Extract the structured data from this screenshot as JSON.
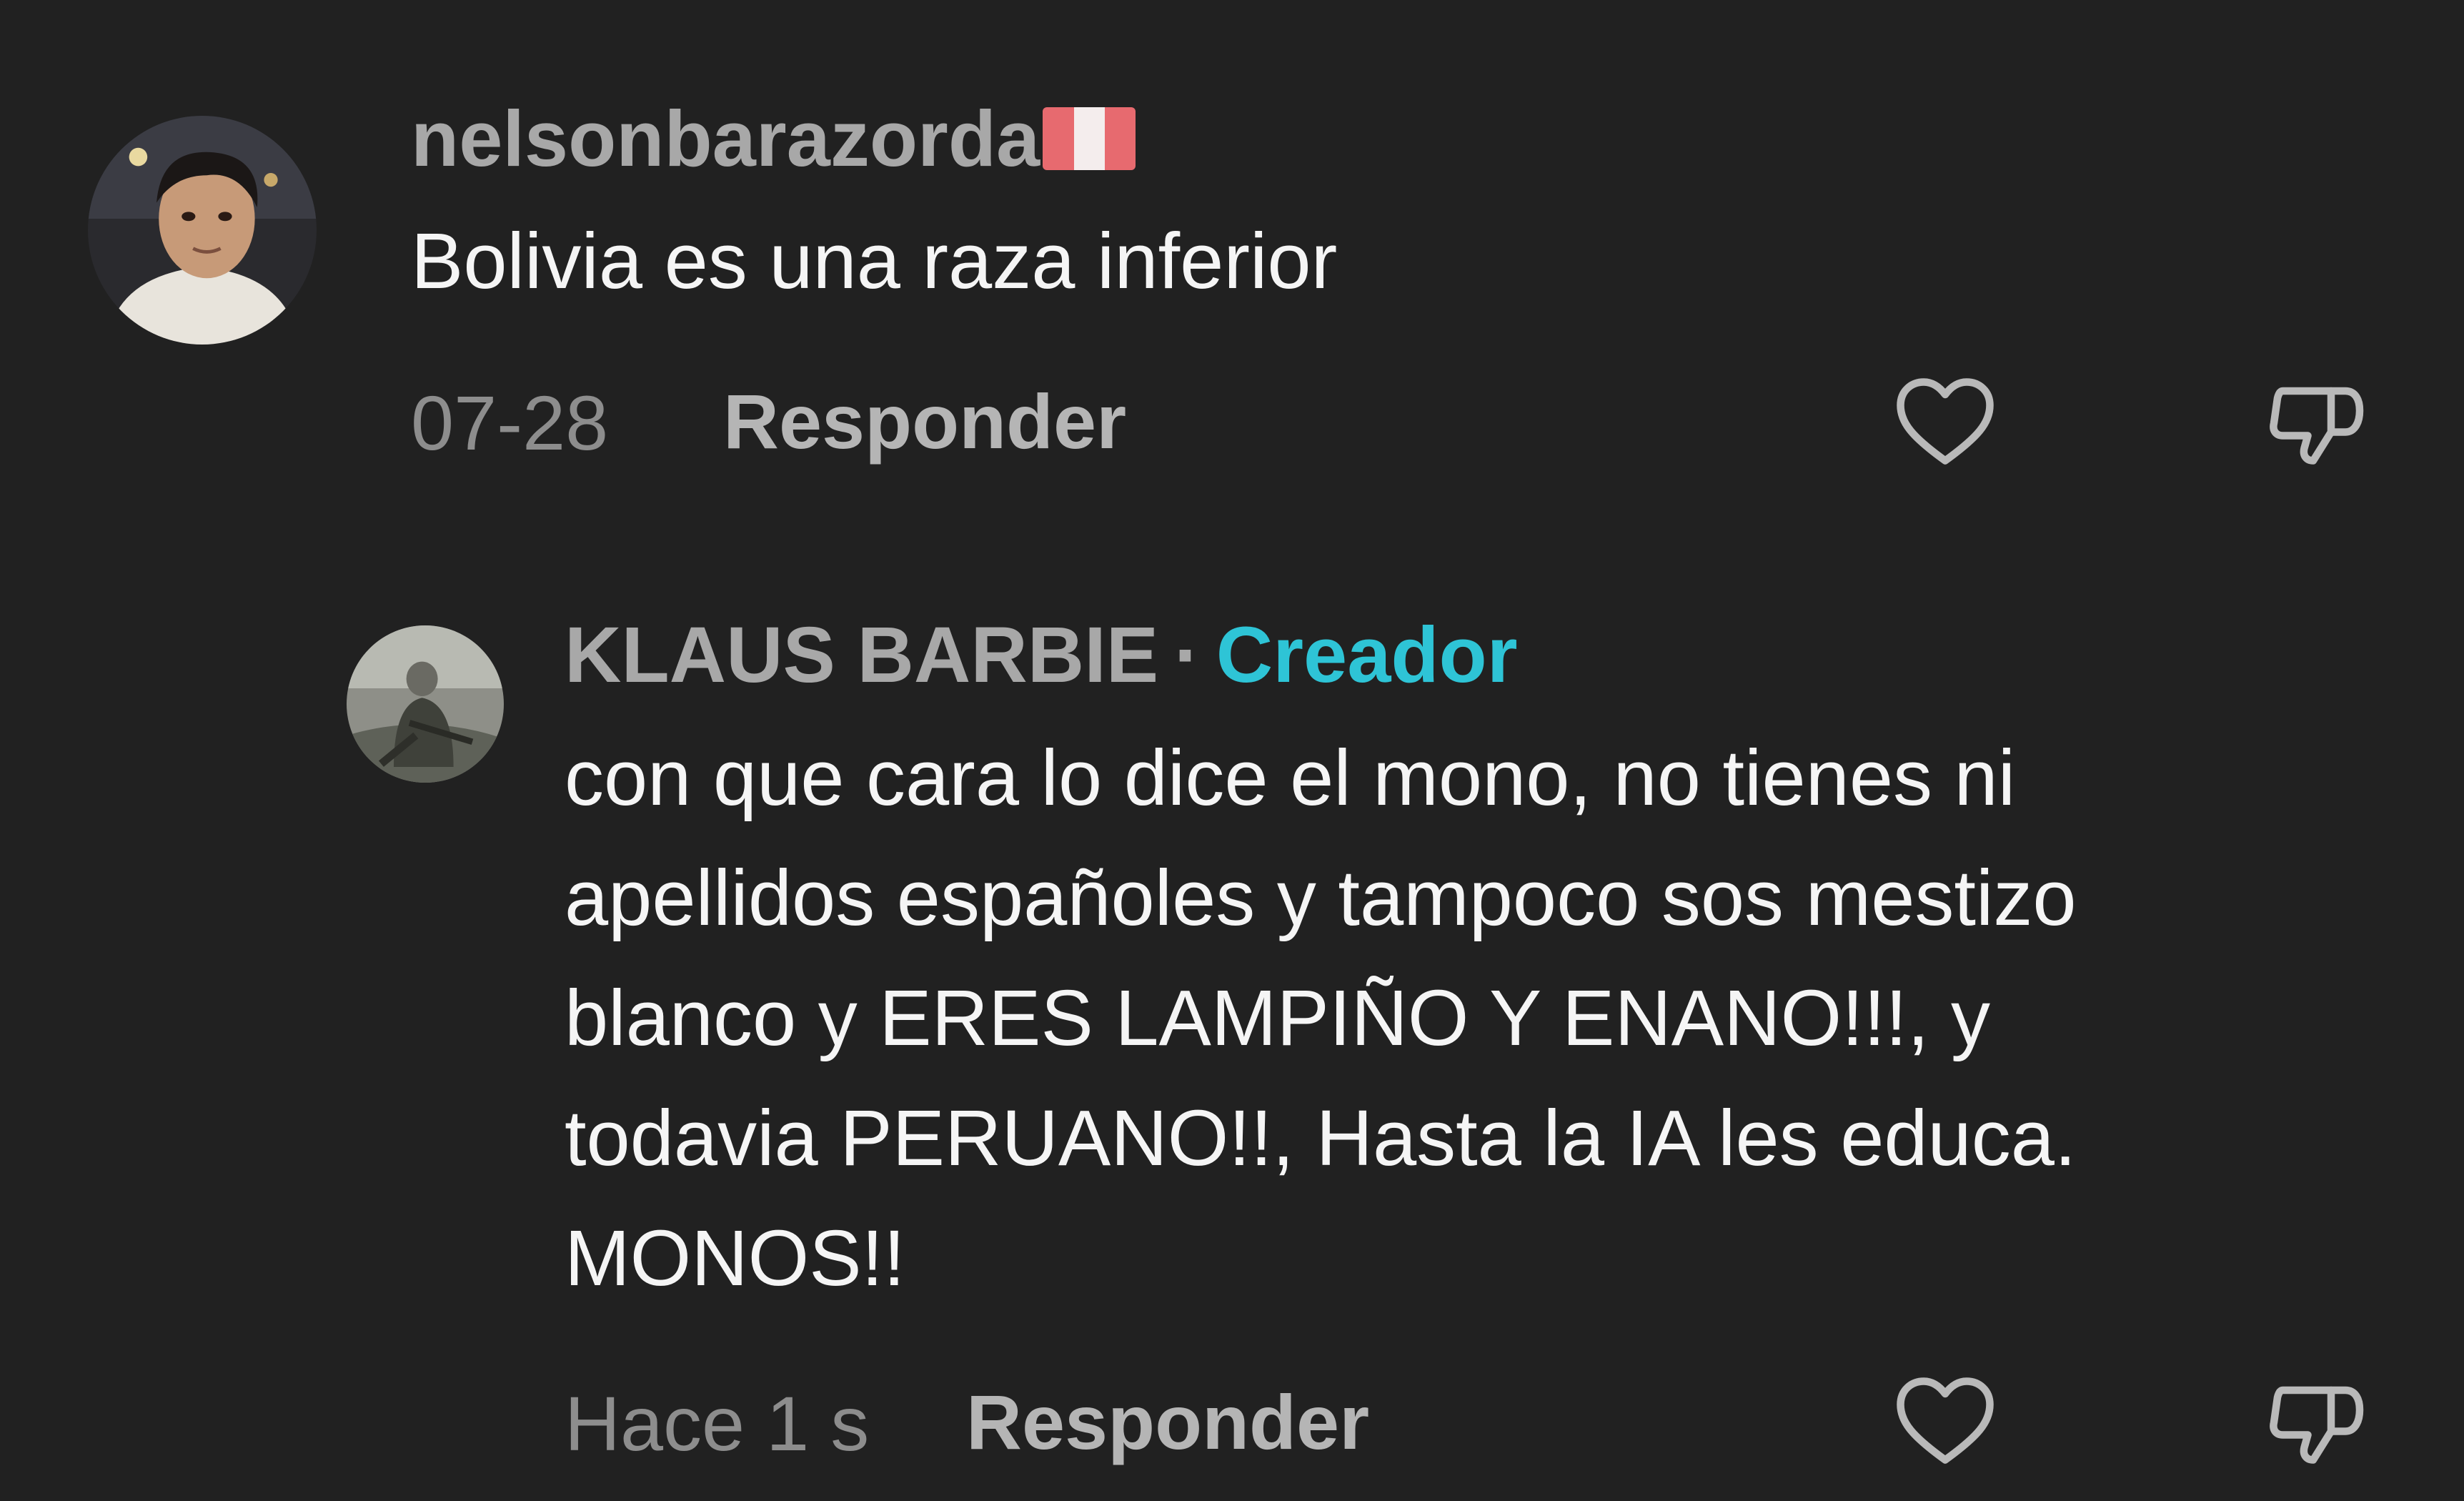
{
  "colors": {
    "background": "#212121",
    "username": "#a8a8a8",
    "text": "#f5f5f5",
    "muted": "#8d8d8d",
    "creator_badge": "#2ec4d6",
    "icon": "#b9b9b9"
  },
  "comment": {
    "username": "nelsonbarazorda",
    "flag_icon": "peru-flag-icon",
    "text": "Bolivia es una raza inferior",
    "date": "07-28",
    "reply_label": "Responder",
    "like_icon": "heart-icon",
    "dislike_icon": "thumbs-down-icon"
  },
  "reply": {
    "username": "KLAUS BARBIE",
    "separator": "·",
    "badge": "Creador",
    "lines": [
      "con que cara lo dice el mono, no tienes ni",
      "apellidos españoles y tampoco sos mestizo",
      "blanco y ERES LAMPIÑO Y ENANO!!!, y",
      "todavia PERUANO!!, Hasta la IA les educa.",
      "MONOS!!"
    ],
    "time": "Hace 1 s",
    "reply_label": "Responder",
    "like_icon": "heart-icon",
    "dislike_icon": "thumbs-down-icon"
  }
}
